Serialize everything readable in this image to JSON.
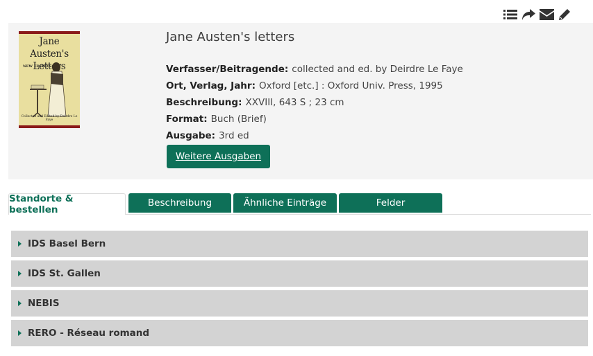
{
  "toolbar": {
    "icons": [
      "list-icon",
      "share-icon",
      "email-icon",
      "edit-icon"
    ]
  },
  "record": {
    "cover": {
      "title_line1": "Jane Austen's",
      "title_line2": "Letters",
      "edition": "NEW EDITION",
      "credit": "Collected and Edited by Deirdre Le Faye"
    },
    "title": "Jane Austen's letters",
    "fields": [
      {
        "label": "Verfasser/Beitragende:",
        "value": "collected and ed. by Deirdre Le Faye"
      },
      {
        "label": "Ort, Verlag, Jahr:",
        "value": "Oxford [etc.] :  Oxford Univ. Press,   1995"
      },
      {
        "label": "Beschreibung:",
        "value": "XXVIII, 643 S ; 23 cm"
      },
      {
        "label": "Format:",
        "value": "Buch (Brief)"
      },
      {
        "label": "Ausgabe:",
        "value": "3rd ed"
      }
    ],
    "editions_button": "Weitere Ausgaben"
  },
  "tabs": [
    {
      "label": "Standorte & bestellen",
      "active": true
    },
    {
      "label": "Beschreibung",
      "active": false
    },
    {
      "label": "Ähnliche Einträge",
      "active": false
    },
    {
      "label": "Felder",
      "active": false
    }
  ],
  "locations": [
    {
      "name": "IDS Basel Bern"
    },
    {
      "name": "IDS St. Gallen"
    },
    {
      "name": "NEBIS"
    },
    {
      "name": "RERO - Réseau romand"
    }
  ],
  "colors": {
    "accent": "#0e7058",
    "panel": "#f4f4f4",
    "location_bar": "#d3d3d3"
  }
}
